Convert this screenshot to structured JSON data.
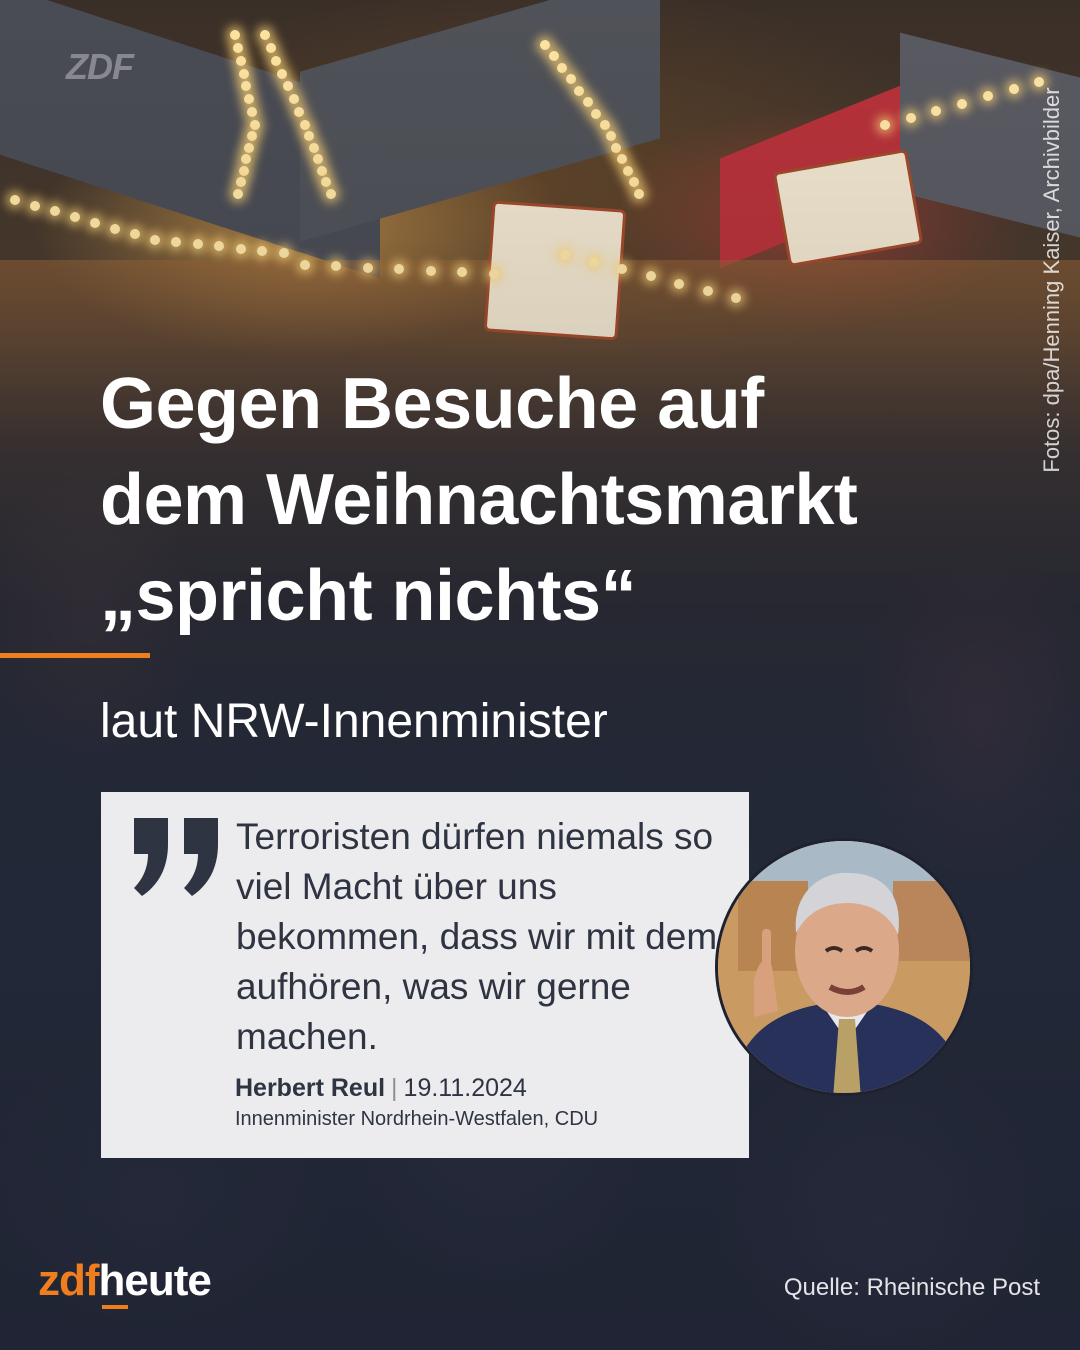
{
  "watermark": "ZDF",
  "photo_credit": "Fotos: dpa/Henning Kaiser, Archivbilder",
  "headline": {
    "line1": "Gegen Besuche auf",
    "line2": "dem Weihnachtsmarkt",
    "line3": "„spricht nichts“"
  },
  "subline": "laut NRW-Innenminister",
  "quote": {
    "text": "Terroristen dürfen niemals so viel Macht über uns bekommen, dass wir mit dem aufhören, was wir gerne machen.",
    "author": "Herbert Reul",
    "separator": "|",
    "date": "19.11.2024",
    "role": "Innenminister Nordrhein-Westfalen, CDU"
  },
  "logo": {
    "part1": "zdf",
    "part2": "heute"
  },
  "source": "Quelle: Rheinische Post",
  "colors": {
    "accent": "#f07e1e",
    "quote_card": "#ececee",
    "quote_text": "#2f3442",
    "headline_text": "#ffffff"
  },
  "icons": {
    "quote": "closing-quote-icon"
  }
}
